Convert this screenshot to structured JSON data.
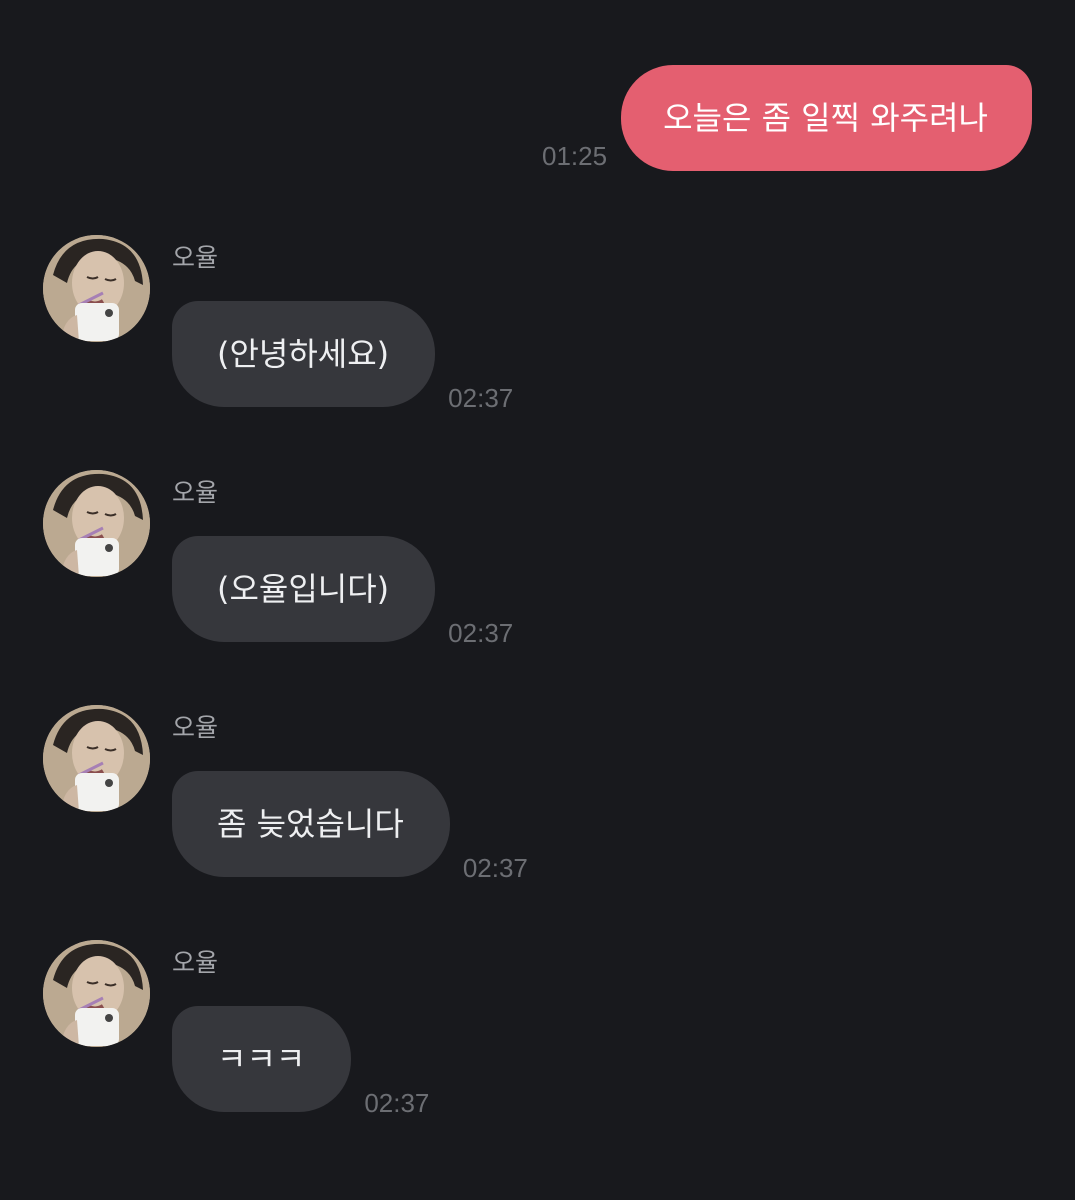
{
  "colors": {
    "background": "#18191d",
    "outgoing_bubble": "#e45f70",
    "incoming_bubble": "#36373c",
    "timestamp": "#6c6e73",
    "sender_name": "#a3a5aa"
  },
  "outgoing": {
    "text": "오늘은 좀 일찍 와주려나",
    "time": "01:25"
  },
  "incoming": [
    {
      "sender": "오율",
      "text": "(안녕하세요)",
      "time": "02:37",
      "avatar_icon": "profile-photo"
    },
    {
      "sender": "오율",
      "text": "(오율입니다)",
      "time": "02:37",
      "avatar_icon": "profile-photo"
    },
    {
      "sender": "오율",
      "text": "좀 늦었습니다",
      "time": "02:37",
      "avatar_icon": "profile-photo"
    },
    {
      "sender": "오율",
      "text": "ㅋㅋㅋ",
      "time": "02:37",
      "avatar_icon": "profile-photo"
    }
  ]
}
